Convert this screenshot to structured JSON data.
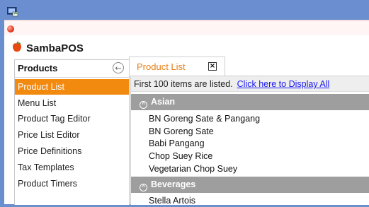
{
  "app": {
    "name": "SambaPOS"
  },
  "sidebar": {
    "title": "Products",
    "items": [
      {
        "label": "Product List",
        "active": true
      },
      {
        "label": "Menu List"
      },
      {
        "label": "Product Tag Editor"
      },
      {
        "label": "Price List Editor"
      },
      {
        "label": "Price Definitions"
      },
      {
        "label": "Tax Templates"
      },
      {
        "label": "Product Timers"
      }
    ]
  },
  "tab": {
    "label": "Product List",
    "close_glyph": "×"
  },
  "list": {
    "info_text": "First 100 items are listed.",
    "display_all_link": "Click here to Display All",
    "groups": [
      {
        "name": "Asian",
        "items": [
          "BN Goreng Sate & Pangang",
          "BN Goreng Sate",
          "Babi Pangang",
          "Chop Suey Rice",
          "Vegetarian Chop Suey"
        ]
      },
      {
        "name": "Beverages",
        "items": [
          "Stella Artois"
        ]
      }
    ]
  },
  "colors": {
    "accent": "#f28a10",
    "group_header": "#9e9e9e",
    "link": "#1a1af0",
    "window_chrome": "#6b8ed0"
  },
  "icons": {
    "window": "app-window-icon",
    "app": "red-ball-icon",
    "logo": "sambapos-logo-icon",
    "back": "back-arrow-icon",
    "group": "collapse-chevron-icon"
  }
}
